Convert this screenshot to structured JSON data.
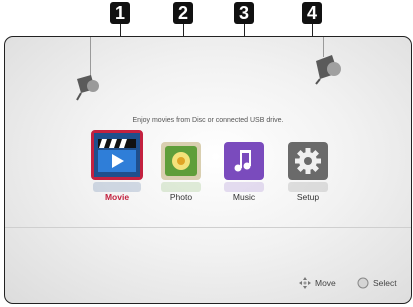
{
  "callouts": [
    "1",
    "2",
    "3",
    "4"
  ],
  "hint_text": "Enjoy movies from Disc or connected USB drive.",
  "menu": [
    {
      "label": "Movie",
      "icon": "movie-icon",
      "selected": true
    },
    {
      "label": "Photo",
      "icon": "photo-icon",
      "selected": false
    },
    {
      "label": "Music",
      "icon": "music-icon",
      "selected": false
    },
    {
      "label": "Setup",
      "icon": "gear-icon",
      "selected": false
    }
  ],
  "footer": {
    "move_label": "Move",
    "select_label": "Select"
  },
  "colors": {
    "accent": "#c3213f",
    "movie_tile": "#1f4f8c",
    "photo_tile": "#d9cfb0",
    "music_tile": "#7a4bbd",
    "setup_tile": "#6a6a6a"
  }
}
